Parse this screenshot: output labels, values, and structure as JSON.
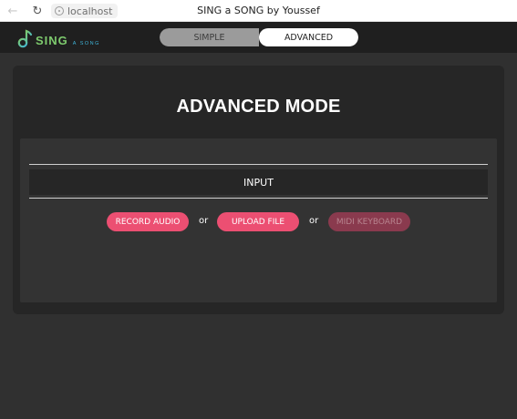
{
  "browser": {
    "url": "localhost",
    "page_title": "SING a SONG by Youssef"
  },
  "header": {
    "logo_main": "SING",
    "logo_sub": "A SONG",
    "modes": [
      {
        "label": "SIMPLE",
        "active": false
      },
      {
        "label": "ADVANCED",
        "active": true
      }
    ]
  },
  "card": {
    "title": "ADVANCED MODE",
    "section_label": "INPUT",
    "actions": {
      "record_label": "RECORD AUDIO",
      "separator_1": "or",
      "upload_label": "UPLOAD FILE",
      "separator_2": "or",
      "midi_label": "MIDI KEYBOARD",
      "midi_enabled": false
    }
  },
  "colors": {
    "accent": "#ec4f72",
    "accent_disabled": "#8a3a4e",
    "logo_green": "#7ecb6e",
    "logo_blue": "#3fb4d8",
    "background": "#303030"
  }
}
